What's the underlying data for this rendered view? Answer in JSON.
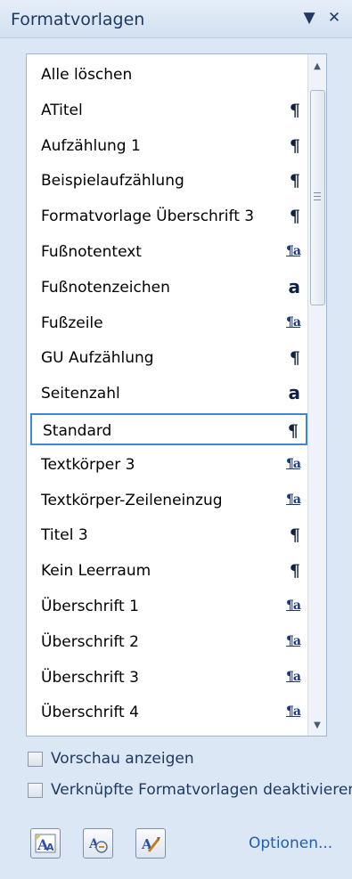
{
  "pane": {
    "title": "Formatvorlagen",
    "dropdown_icon": "chevron-down-icon",
    "close_icon": "close-icon"
  },
  "styles": [
    {
      "label": "Alle löschen",
      "icon": ""
    },
    {
      "label": "ATitel",
      "icon": "¶"
    },
    {
      "label": "Aufzählung 1",
      "icon": "¶"
    },
    {
      "label": "Beispielaufzählung",
      "icon": "¶"
    },
    {
      "label": "Formatvorlage Überschrift 3",
      "icon": "¶"
    },
    {
      "label": "Fußnotentext",
      "icon": "¶a"
    },
    {
      "label": "Fußnotenzeichen",
      "icon": "a"
    },
    {
      "label": "Fußzeile",
      "icon": "¶a"
    },
    {
      "label": "GU Aufzählung",
      "icon": "¶"
    },
    {
      "label": "Seitenzahl",
      "icon": "a"
    },
    {
      "label": "Standard",
      "icon": "¶",
      "selected": true
    },
    {
      "label": "Textkörper 3",
      "icon": "¶a"
    },
    {
      "label": "Textkörper-Zeileneinzug",
      "icon": "¶a"
    },
    {
      "label": "Titel 3",
      "icon": "¶"
    },
    {
      "label": "Kein Leerraum",
      "icon": "¶"
    },
    {
      "label": "Überschrift 1",
      "icon": "¶a"
    },
    {
      "label": "Überschrift 2",
      "icon": "¶a"
    },
    {
      "label": "Überschrift 3",
      "icon": "¶a"
    },
    {
      "label": "Überschrift 4",
      "icon": "¶a"
    }
  ],
  "options": {
    "preview_label": "Vorschau anzeigen",
    "preview_checked": false,
    "linked_label": "Verknüpfte Formatvorlagen deaktivieren",
    "linked_checked": false
  },
  "footer": {
    "new_style_icon": "new-style-icon",
    "style_inspector_icon": "style-inspector-icon",
    "manage_styles_icon": "manage-styles-icon",
    "options_link": "Optionen..."
  },
  "colors": {
    "accent": "#3f86d3",
    "title_text": "#1e3a63",
    "link": "#1f5fb0"
  }
}
